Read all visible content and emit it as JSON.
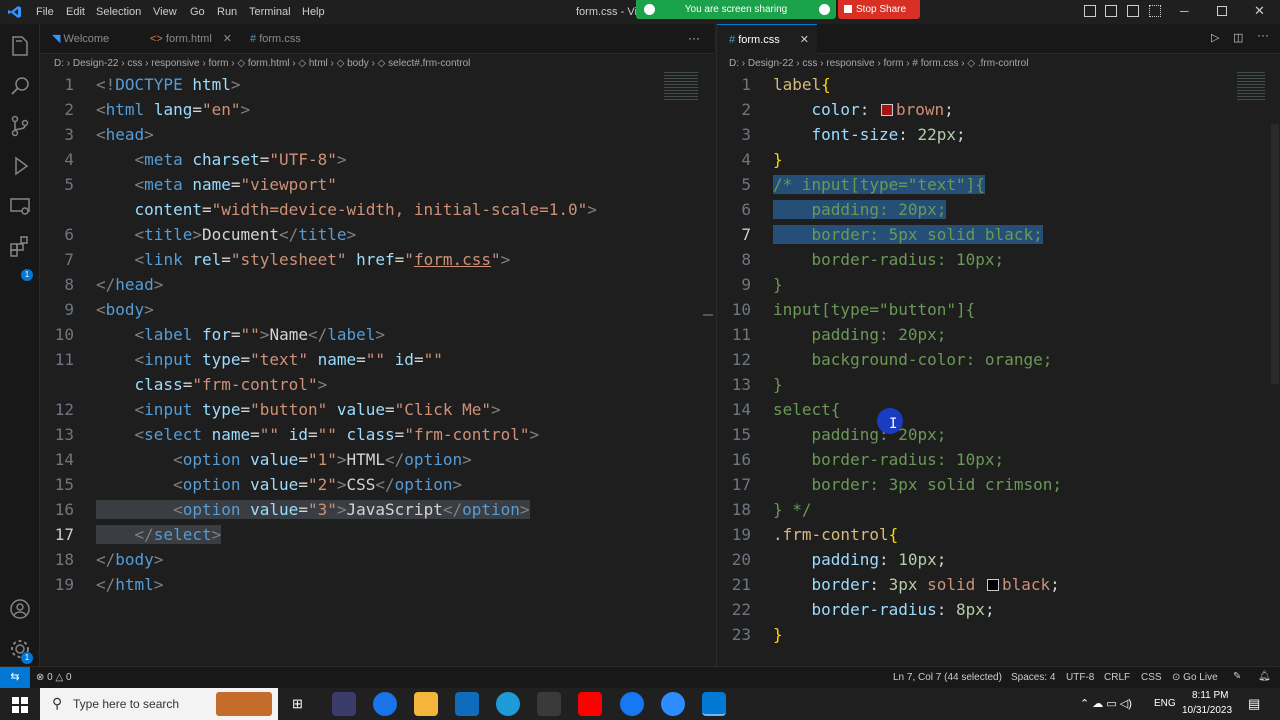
{
  "titlebar": {
    "app_icon": "vscode-icon",
    "menus": [
      "File",
      "Edit",
      "Selection",
      "View",
      "Go",
      "Run",
      "Terminal",
      "Help"
    ],
    "title": "form.css - Vis",
    "share_banner": "You are screen sharing",
    "stop_share": "Stop Share"
  },
  "left": {
    "tabs": [
      {
        "label": "Welcome",
        "icon": "vscode-icon"
      },
      {
        "label": "form.html",
        "icon": "html-icon"
      },
      {
        "label": "form.css",
        "icon": "css-icon"
      }
    ],
    "breadcrumb": "D: › Design-22 › css › responsive › form › ◇ form.html › ◇ html › ◇ body › ◇ select#.frm-control",
    "lines": [
      [
        [
          "t",
          "<!"
        ],
        [
          "g",
          "DOCTYPE"
        ],
        [
          "w",
          " "
        ],
        [
          "a",
          "html"
        ],
        [
          "t",
          ">"
        ]
      ],
      [
        [
          "t",
          "<"
        ],
        [
          "g",
          "html"
        ],
        [
          "w",
          " "
        ],
        [
          "a",
          "lang"
        ],
        [
          "w",
          "="
        ],
        [
          "s",
          "\"en\""
        ],
        [
          "t",
          ">"
        ]
      ],
      [
        [
          "t",
          "<"
        ],
        [
          "g",
          "head"
        ],
        [
          "t",
          ">"
        ]
      ],
      [
        [
          "w",
          "    "
        ],
        [
          "t",
          "<"
        ],
        [
          "g",
          "meta"
        ],
        [
          "w",
          " "
        ],
        [
          "a",
          "charset"
        ],
        [
          "w",
          "="
        ],
        [
          "s",
          "\"UTF-8\""
        ],
        [
          "t",
          ">"
        ]
      ],
      [
        [
          "w",
          "    "
        ],
        [
          "t",
          "<"
        ],
        [
          "g",
          "meta"
        ],
        [
          "w",
          " "
        ],
        [
          "a",
          "name"
        ],
        [
          "w",
          "="
        ],
        [
          "s",
          "\"viewport\""
        ]
      ],
      [
        [
          "w",
          "    "
        ],
        [
          "a",
          "content"
        ],
        [
          "w",
          "="
        ],
        [
          "s",
          "\"width=device-width, initial-scale=1.0\""
        ],
        [
          "t",
          ">"
        ]
      ],
      [
        [
          "w",
          "    "
        ],
        [
          "t",
          "<"
        ],
        [
          "g",
          "title"
        ],
        [
          "t",
          ">"
        ],
        [
          "w",
          "Document"
        ],
        [
          "t",
          "</"
        ],
        [
          "g",
          "title"
        ],
        [
          "t",
          ">"
        ]
      ],
      [
        [
          "w",
          "    "
        ],
        [
          "t",
          "<"
        ],
        [
          "g",
          "link"
        ],
        [
          "w",
          " "
        ],
        [
          "a",
          "rel"
        ],
        [
          "w",
          "="
        ],
        [
          "s",
          "\"stylesheet\""
        ],
        [
          "w",
          " "
        ],
        [
          "a",
          "href"
        ],
        [
          "w",
          "="
        ],
        [
          "s",
          "\""
        ],
        [
          "su",
          "form.css"
        ],
        [
          "s",
          "\""
        ],
        [
          "t",
          ">"
        ]
      ],
      [
        [
          "t",
          "</"
        ],
        [
          "g",
          "head"
        ],
        [
          "t",
          ">"
        ]
      ],
      [
        [
          "t",
          "<"
        ],
        [
          "g",
          "body"
        ],
        [
          "t",
          ">"
        ]
      ],
      [
        [
          "w",
          "    "
        ],
        [
          "t",
          "<"
        ],
        [
          "g",
          "label"
        ],
        [
          "w",
          " "
        ],
        [
          "a",
          "for"
        ],
        [
          "w",
          "="
        ],
        [
          "s",
          "\"\""
        ],
        [
          "t",
          ">"
        ],
        [
          "w",
          "Name"
        ],
        [
          "t",
          "</"
        ],
        [
          "g",
          "label"
        ],
        [
          "t",
          ">"
        ]
      ],
      [
        [
          "w",
          "    "
        ],
        [
          "t",
          "<"
        ],
        [
          "g",
          "input"
        ],
        [
          "w",
          " "
        ],
        [
          "a",
          "type"
        ],
        [
          "w",
          "="
        ],
        [
          "s",
          "\"text\""
        ],
        [
          "w",
          " "
        ],
        [
          "a",
          "name"
        ],
        [
          "w",
          "="
        ],
        [
          "s",
          "\"\""
        ],
        [
          "w",
          " "
        ],
        [
          "a",
          "id"
        ],
        [
          "w",
          "="
        ],
        [
          "s",
          "\"\""
        ]
      ],
      [
        [
          "w",
          "    "
        ],
        [
          "a",
          "class"
        ],
        [
          "w",
          "="
        ],
        [
          "s",
          "\"frm-control\""
        ],
        [
          "t",
          ">"
        ]
      ],
      [
        [
          "w",
          "    "
        ],
        [
          "t",
          "<"
        ],
        [
          "g",
          "input"
        ],
        [
          "w",
          " "
        ],
        [
          "a",
          "type"
        ],
        [
          "w",
          "="
        ],
        [
          "s",
          "\"button\""
        ],
        [
          "w",
          " "
        ],
        [
          "a",
          "value"
        ],
        [
          "w",
          "="
        ],
        [
          "s",
          "\"Click Me\""
        ],
        [
          "t",
          ">"
        ]
      ],
      [
        [
          "w",
          "    "
        ],
        [
          "t",
          "<"
        ],
        [
          "g",
          "select"
        ],
        [
          "w",
          " "
        ],
        [
          "a",
          "name"
        ],
        [
          "w",
          "="
        ],
        [
          "s",
          "\"\""
        ],
        [
          "w",
          " "
        ],
        [
          "a",
          "id"
        ],
        [
          "w",
          "="
        ],
        [
          "s",
          "\"\""
        ],
        [
          "w",
          " "
        ],
        [
          "a",
          "class"
        ],
        [
          "w",
          "="
        ],
        [
          "s",
          "\"frm-control\""
        ],
        [
          "t",
          ">"
        ]
      ],
      [
        [
          "w",
          "        "
        ],
        [
          "t",
          "<"
        ],
        [
          "g",
          "option"
        ],
        [
          "w",
          " "
        ],
        [
          "a",
          "value"
        ],
        [
          "w",
          "="
        ],
        [
          "s",
          "\"1\""
        ],
        [
          "t",
          ">"
        ],
        [
          "w",
          "HTML"
        ],
        [
          "t",
          "</"
        ],
        [
          "g",
          "option"
        ],
        [
          "t",
          ">"
        ]
      ],
      [
        [
          "w",
          "        "
        ],
        [
          "t",
          "<"
        ],
        [
          "g",
          "option"
        ],
        [
          "w",
          " "
        ],
        [
          "a",
          "value"
        ],
        [
          "w",
          "="
        ],
        [
          "s",
          "\"2\""
        ],
        [
          "t",
          ">"
        ],
        [
          "w",
          "CSS"
        ],
        [
          "t",
          "</"
        ],
        [
          "g",
          "option"
        ],
        [
          "t",
          ">"
        ]
      ],
      [
        [
          "w",
          "        "
        ],
        [
          "t",
          "<"
        ],
        [
          "g",
          "option"
        ],
        [
          "w",
          " "
        ],
        [
          "a",
          "value"
        ],
        [
          "w",
          "="
        ],
        [
          "s",
          "\"3\""
        ],
        [
          "t",
          ">"
        ],
        [
          "w",
          "JavaScript"
        ],
        [
          "t",
          "</"
        ],
        [
          "g",
          "option"
        ],
        [
          "t",
          ">"
        ]
      ],
      [
        [
          "w",
          "    "
        ],
        [
          "t",
          "</"
        ],
        [
          "g",
          "select"
        ],
        [
          "t",
          ">"
        ]
      ],
      [
        [
          "t",
          "</"
        ],
        [
          "g",
          "body"
        ],
        [
          "t",
          ">"
        ]
      ],
      [
        [
          "t",
          "</"
        ],
        [
          "g",
          "html"
        ],
        [
          "t",
          ">"
        ]
      ]
    ],
    "numbers": [
      "1",
      "2",
      "3",
      "4",
      "5",
      "",
      "6",
      "7",
      "8",
      "9",
      "10",
      "11",
      "",
      "12",
      "13",
      "14",
      "15",
      "16",
      "17",
      "18",
      "19"
    ],
    "current_line": "17"
  },
  "right": {
    "tabs": [
      {
        "label": "form.css",
        "icon": "css-icon"
      }
    ],
    "breadcrumb": "D: › Design-22 › css › responsive › form › # form.css › ◇ .frm-control",
    "lines": [
      [
        [
          "cl",
          "label"
        ],
        [
          "y",
          "{"
        ]
      ],
      [
        [
          "w",
          "    "
        ],
        [
          "a",
          "color"
        ],
        [
          "w",
          ": "
        ],
        [
          "sw",
          "#a31515"
        ],
        [
          "s",
          "brown"
        ],
        [
          "w",
          ";"
        ]
      ],
      [
        [
          "w",
          "    "
        ],
        [
          "a",
          "font-size"
        ],
        [
          "w",
          ": "
        ],
        [
          "n",
          "22px"
        ],
        [
          "w",
          ";"
        ]
      ],
      [
        [
          "y",
          "}"
        ]
      ],
      [
        [
          "c",
          "/* input[type=\"text\"]{"
        ]
      ],
      [
        [
          "c",
          "    padding: 20px;"
        ]
      ],
      [
        [
          "c",
          "    border: 5px solid black;"
        ]
      ],
      [
        [
          "c",
          "    border-radius: 10px;"
        ]
      ],
      [
        [
          "c",
          "}"
        ]
      ],
      [
        [
          "c",
          "input[type=\"button\"]{"
        ]
      ],
      [
        [
          "c",
          "    padding: 20px;"
        ]
      ],
      [
        [
          "c",
          "    background-color: orange;"
        ]
      ],
      [
        [
          "c",
          "}"
        ]
      ],
      [
        [
          "c",
          "select{"
        ]
      ],
      [
        [
          "c",
          "    padding: 20px;"
        ]
      ],
      [
        [
          "c",
          "    border-radius: 10px;"
        ]
      ],
      [
        [
          "c",
          "    border: 3px solid crimson;"
        ]
      ],
      [
        [
          "c",
          "} */"
        ]
      ],
      [
        [
          "cl",
          ".frm-control"
        ],
        [
          "y",
          "{"
        ]
      ],
      [
        [
          "w",
          "    "
        ],
        [
          "a",
          "padding"
        ],
        [
          "w",
          ": "
        ],
        [
          "n",
          "10px"
        ],
        [
          "w",
          ";"
        ]
      ],
      [
        [
          "w",
          "    "
        ],
        [
          "a",
          "border"
        ],
        [
          "w",
          ": "
        ],
        [
          "n",
          "3px"
        ],
        [
          "w",
          " "
        ],
        [
          "s",
          "solid"
        ],
        [
          "w",
          " "
        ],
        [
          "sw",
          "#000000"
        ],
        [
          "s",
          "black"
        ],
        [
          "w",
          ";"
        ]
      ],
      [
        [
          "w",
          "    "
        ],
        [
          "a",
          "border-radius"
        ],
        [
          "w",
          ": "
        ],
        [
          "n",
          "8px"
        ],
        [
          "w",
          ";"
        ]
      ],
      [
        [
          "y",
          "}"
        ]
      ]
    ],
    "numbers": [
      "1",
      "2",
      "3",
      "4",
      "5",
      "6",
      "7",
      "8",
      "9",
      "10",
      "11",
      "12",
      "13",
      "14",
      "15",
      "16",
      "17",
      "18",
      "19",
      "20",
      "21",
      "22",
      "23"
    ],
    "current_line": "7"
  },
  "statusbar": {
    "remote_icon": "remote-icon",
    "errors": "0",
    "warnings": "0",
    "position": "Ln 7, Col 7 (44 selected)",
    "spaces": "Spaces: 4",
    "encoding": "UTF-8",
    "eol": "CRLF",
    "language": "CSS",
    "golive": "Go Live"
  },
  "taskbar": {
    "search_placeholder": "Type here to search",
    "time": "8:11 PM",
    "date": "10/31/2023",
    "lang": "ENG"
  },
  "colors": {
    "accent": "#0078d4",
    "share_green": "#1aa34a",
    "stop_red": "#d93025"
  }
}
